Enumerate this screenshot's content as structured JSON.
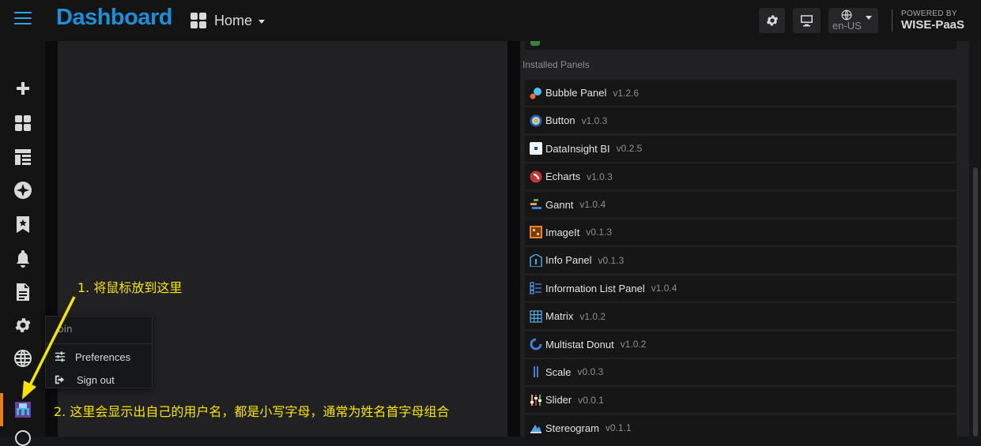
{
  "topbar": {
    "brand": "Dashboard",
    "home_label": "Home",
    "language": "en-US",
    "powered_by_line1": "POWERED BY",
    "powered_by_line2": "WISE-PaaS"
  },
  "sidebar": {
    "items": [
      {
        "icon": "plus-icon"
      },
      {
        "icon": "dashboards-grid-icon"
      },
      {
        "icon": "layout-icon"
      },
      {
        "icon": "compass-icon"
      },
      {
        "icon": "bookmark-star-icon"
      },
      {
        "icon": "bell-icon"
      },
      {
        "icon": "document-icon"
      },
      {
        "icon": "gear-icon"
      },
      {
        "icon": "globe-icon"
      },
      {
        "icon": "user-avatar-icon"
      }
    ]
  },
  "user_menu": {
    "username": "bin",
    "preferences_label": "Preferences",
    "signout_label": "Sign out"
  },
  "panels": {
    "section_title": "Installed Panels",
    "items": [
      {
        "name": "Bubble Panel",
        "version": "v1.2.6",
        "icon": "bubble-icon"
      },
      {
        "name": "Button",
        "version": "v1.0.3",
        "icon": "button-icon"
      },
      {
        "name": "DataInsight BI",
        "version": "v0.2.5",
        "icon": "datainsight-icon"
      },
      {
        "name": "Echarts",
        "version": "v1.0.3",
        "icon": "echarts-icon"
      },
      {
        "name": "Gannt",
        "version": "v1.0.4",
        "icon": "gantt-icon"
      },
      {
        "name": "ImageIt",
        "version": "v0.1.3",
        "icon": "imageit-icon"
      },
      {
        "name": "Info Panel",
        "version": "v0.1.3",
        "icon": "info-panel-icon"
      },
      {
        "name": "Information List Panel",
        "version": "v1.0.4",
        "icon": "info-list-icon"
      },
      {
        "name": "Matrix",
        "version": "v1.0.2",
        "icon": "matrix-icon"
      },
      {
        "name": "Multistat Donut",
        "version": "v1.0.2",
        "icon": "donut-icon"
      },
      {
        "name": "Scale",
        "version": "v0.0.3",
        "icon": "scale-icon"
      },
      {
        "name": "Slider",
        "version": "v0.0.1",
        "icon": "slider-icon"
      },
      {
        "name": "Stereogram",
        "version": "v0.1.1",
        "icon": "stereogram-icon"
      }
    ]
  },
  "annotations": {
    "note1": "1. 将鼠标放到这里",
    "note2": "2. 这里会显示出自己的用户名，都是小写字母，通常为姓名首字母组合"
  },
  "colors": {
    "brand": "#1c8fd8",
    "annotation": "#f5e400",
    "active_indicator": "#eb7b18"
  }
}
